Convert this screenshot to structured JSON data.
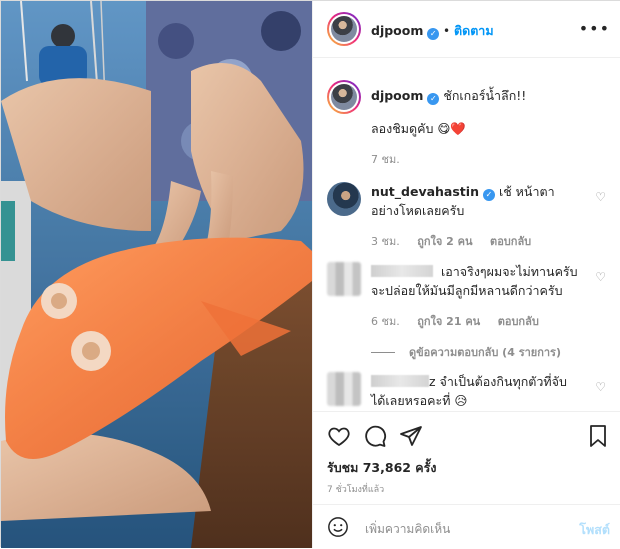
{
  "post": {
    "username": "djpoom",
    "follow_label": "ติดตาม",
    "more_label": "•••",
    "caption_main": "ชักเกอร์น้ำลึก!!",
    "caption_sub": "ลองชิมดูคับ",
    "caption_emoji": "😋❤️",
    "caption_time": "7 ชม."
  },
  "comments": [
    {
      "username": "nut_devahastin",
      "text": "เช้ หน้าตาอย่างโหดเลยครับ",
      "time": "3 ชม.",
      "likes": "ถูกใจ 2 คน",
      "reply": "ตอบกลับ"
    },
    {
      "username": "",
      "text": "เอาจริงๆผมจะไม่ทานครับ จะปล่อยให้มันมีลูกมีหลานดีกว่าครับ",
      "time": "6 ชม.",
      "likes": "ถูกใจ 21 คน",
      "reply": "ตอบกลับ",
      "view_replies": "ดูข้อความตอบกลับ (4 รายการ)"
    },
    {
      "username": "",
      "suffix": "z",
      "text": "จำเป็นต้องกินทุกตัวที่จับได้เลยหรอคะที่",
      "emoji": "😥"
    }
  ],
  "footer": {
    "likes_label": "รับชม 73,862 ครั้ง",
    "time_ago": "7 ชั่วโมงที่แล้ว",
    "comment_placeholder": "เพิ่มความคิดเห็น",
    "post_label": "โพสต์"
  },
  "icons": {
    "like": "heart-icon",
    "comment": "comment-icon",
    "share": "share-icon",
    "save": "bookmark-icon",
    "emoji": "smiley-icon",
    "verified": "verified-badge-icon"
  },
  "colors": {
    "accent": "#0095f6",
    "verified": "#3897f0",
    "muted": "#8e8e8e",
    "post_disabled": "#b2dffc",
    "fish": "#f27a3e"
  }
}
